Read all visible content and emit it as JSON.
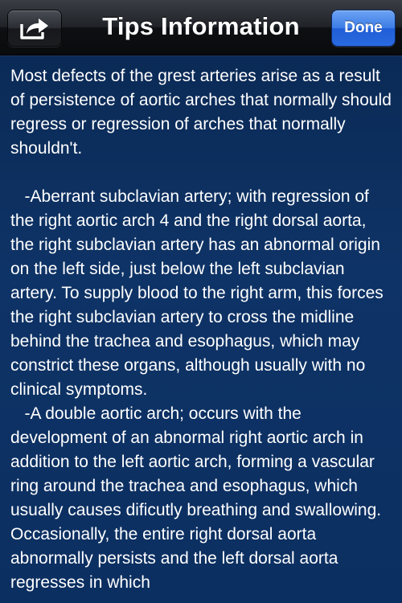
{
  "navbar": {
    "title": "Tips Information",
    "done_label": "Done",
    "share_icon": "share-icon"
  },
  "content": {
    "paragraphs": [
      "Most defects of the grest arteries arise as a result of persistence of aortic arches that normally should regress or regression of arches that normally shouldn't.",
      "   -Aberrant subclavian artery; with regression of the right aortic arch 4 and the right dorsal aorta, the right subclavian artery has an abnormal origin on the left side, just below the left subclavian artery. To supply blood to the right arm, this forces the right subclavian artery to cross the midline behind the trachea and esophagus, which may constrict these organs, although usually with no clinical symptoms.",
      "   -A double aortic arch; occurs with the development of an abnormal right aortic arch in addition to the left aortic arch, forming a vascular ring around the trachea and esophagus, which usually causes dificutly breathing and swallowing. Occasionally, the entire right dorsal aorta abnormally persists and the left dorsal aorta regresses in which"
    ]
  },
  "colors": {
    "background": "#0e3366",
    "navbar": "#16181c",
    "done_button": "#2f6fe0",
    "text": "#ffffff"
  }
}
